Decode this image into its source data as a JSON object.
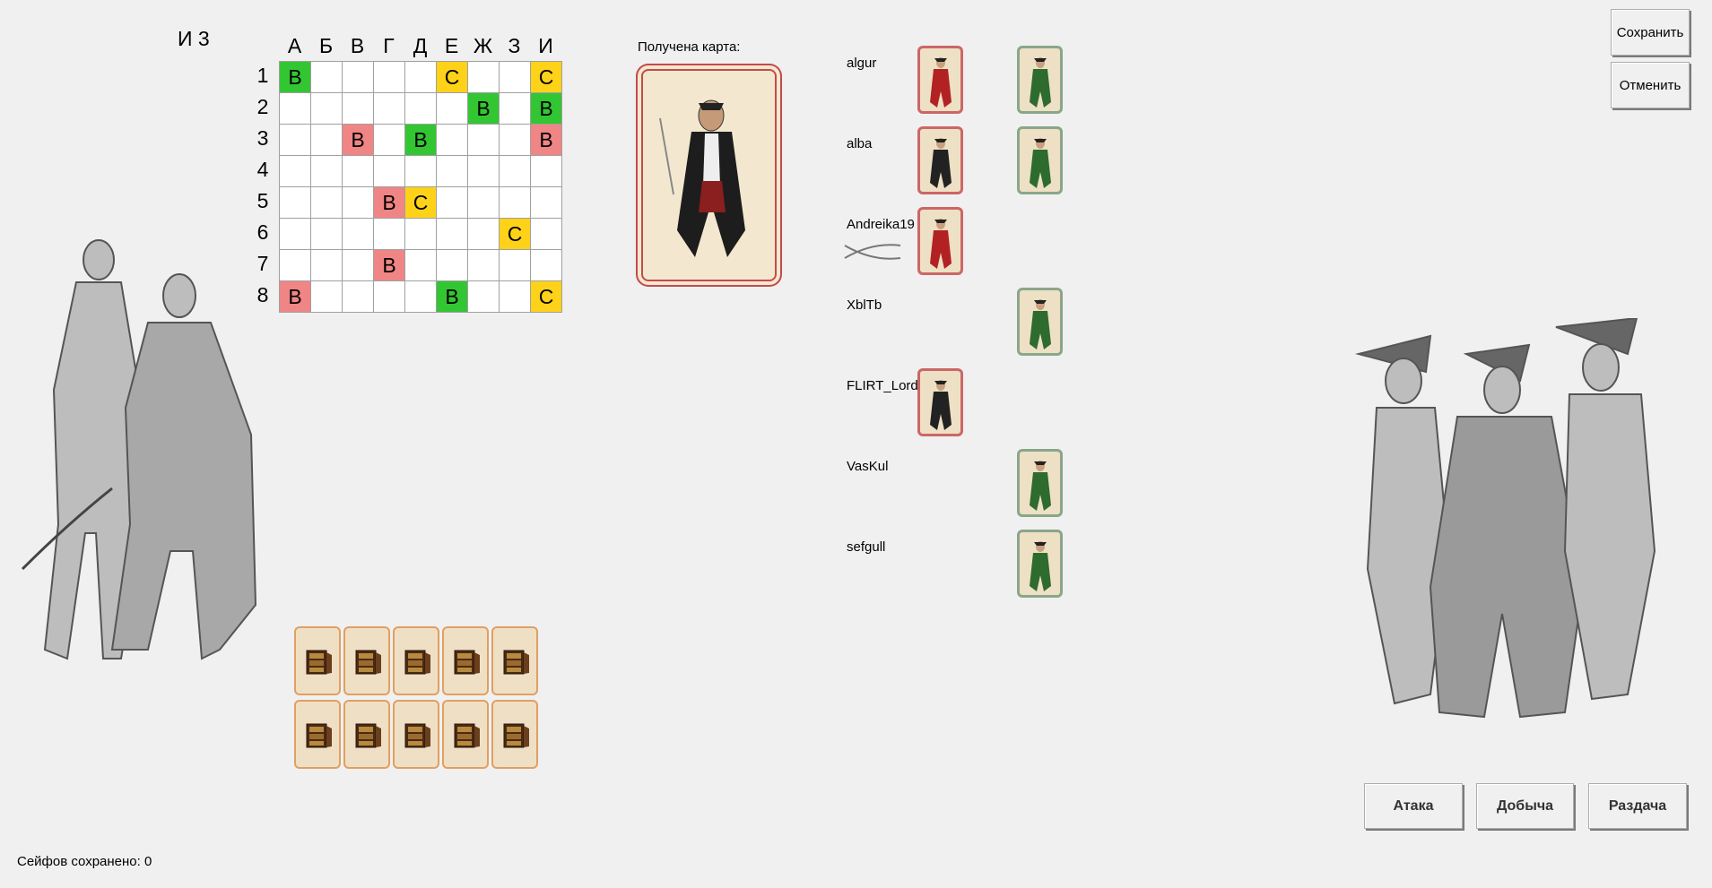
{
  "grid": {
    "title": "И 3",
    "columns": [
      "А",
      "Б",
      "В",
      "Г",
      "Д",
      "Е",
      "Ж",
      "З",
      "И"
    ],
    "rows": [
      "1",
      "2",
      "3",
      "4",
      "5",
      "6",
      "7",
      "8"
    ],
    "cells": [
      [
        {
          "t": "В",
          "c": "green"
        },
        {
          "t": "",
          "c": ""
        },
        {
          "t": "",
          "c": ""
        },
        {
          "t": "",
          "c": ""
        },
        {
          "t": "",
          "c": ""
        },
        {
          "t": "С",
          "c": "yellow"
        },
        {
          "t": "",
          "c": ""
        },
        {
          "t": "",
          "c": ""
        },
        {
          "t": "С",
          "c": "yellow"
        }
      ],
      [
        {
          "t": "",
          "c": ""
        },
        {
          "t": "",
          "c": ""
        },
        {
          "t": "",
          "c": ""
        },
        {
          "t": "",
          "c": ""
        },
        {
          "t": "",
          "c": ""
        },
        {
          "t": "",
          "c": ""
        },
        {
          "t": "В",
          "c": "green"
        },
        {
          "t": "",
          "c": ""
        },
        {
          "t": "В",
          "c": "green"
        }
      ],
      [
        {
          "t": "",
          "c": ""
        },
        {
          "t": "",
          "c": ""
        },
        {
          "t": "В",
          "c": "red"
        },
        {
          "t": "",
          "c": ""
        },
        {
          "t": "В",
          "c": "green"
        },
        {
          "t": "",
          "c": ""
        },
        {
          "t": "",
          "c": ""
        },
        {
          "t": "",
          "c": ""
        },
        {
          "t": "В",
          "c": "red"
        }
      ],
      [
        {
          "t": "",
          "c": ""
        },
        {
          "t": "",
          "c": ""
        },
        {
          "t": "",
          "c": ""
        },
        {
          "t": "",
          "c": ""
        },
        {
          "t": "",
          "c": ""
        },
        {
          "t": "",
          "c": ""
        },
        {
          "t": "",
          "c": ""
        },
        {
          "t": "",
          "c": ""
        },
        {
          "t": "",
          "c": ""
        }
      ],
      [
        {
          "t": "",
          "c": ""
        },
        {
          "t": "",
          "c": ""
        },
        {
          "t": "",
          "c": ""
        },
        {
          "t": "В",
          "c": "red"
        },
        {
          "t": "С",
          "c": "yellow"
        },
        {
          "t": "",
          "c": ""
        },
        {
          "t": "",
          "c": ""
        },
        {
          "t": "",
          "c": ""
        },
        {
          "t": "",
          "c": ""
        }
      ],
      [
        {
          "t": "",
          "c": ""
        },
        {
          "t": "",
          "c": ""
        },
        {
          "t": "",
          "c": ""
        },
        {
          "t": "",
          "c": ""
        },
        {
          "t": "",
          "c": ""
        },
        {
          "t": "",
          "c": ""
        },
        {
          "t": "",
          "c": ""
        },
        {
          "t": "С",
          "c": "yellow"
        },
        {
          "t": "",
          "c": ""
        }
      ],
      [
        {
          "t": "",
          "c": ""
        },
        {
          "t": "",
          "c": ""
        },
        {
          "t": "",
          "c": ""
        },
        {
          "t": "В",
          "c": "red"
        },
        {
          "t": "",
          "c": ""
        },
        {
          "t": "",
          "c": ""
        },
        {
          "t": "",
          "c": ""
        },
        {
          "t": "",
          "c": ""
        },
        {
          "t": "",
          "c": ""
        }
      ],
      [
        {
          "t": "В",
          "c": "red"
        },
        {
          "t": "",
          "c": ""
        },
        {
          "t": "",
          "c": ""
        },
        {
          "t": "",
          "c": ""
        },
        {
          "t": "",
          "c": ""
        },
        {
          "t": "В",
          "c": "green"
        },
        {
          "t": "",
          "c": ""
        },
        {
          "t": "",
          "c": ""
        },
        {
          "t": "С",
          "c": "yellow"
        }
      ]
    ]
  },
  "received": {
    "label": "Получена карта:"
  },
  "players": [
    {
      "name": "algur"
    },
    {
      "name": "alba"
    },
    {
      "name": "Andreika19"
    },
    {
      "name": "XblTb"
    },
    {
      "name": "FLIRT_Lord2"
    },
    {
      "name": "VasKul"
    },
    {
      "name": "sefgull"
    }
  ],
  "buttons": {
    "save": "Сохранить",
    "cancel": "Отменить",
    "attack": "Атака",
    "loot": "Добыча",
    "deal": "Раздача"
  },
  "status": "Сейфов сохранено: 0",
  "colors": {
    "green": "#33c633",
    "red": "#f08585",
    "yellow": "#ffd21a"
  }
}
